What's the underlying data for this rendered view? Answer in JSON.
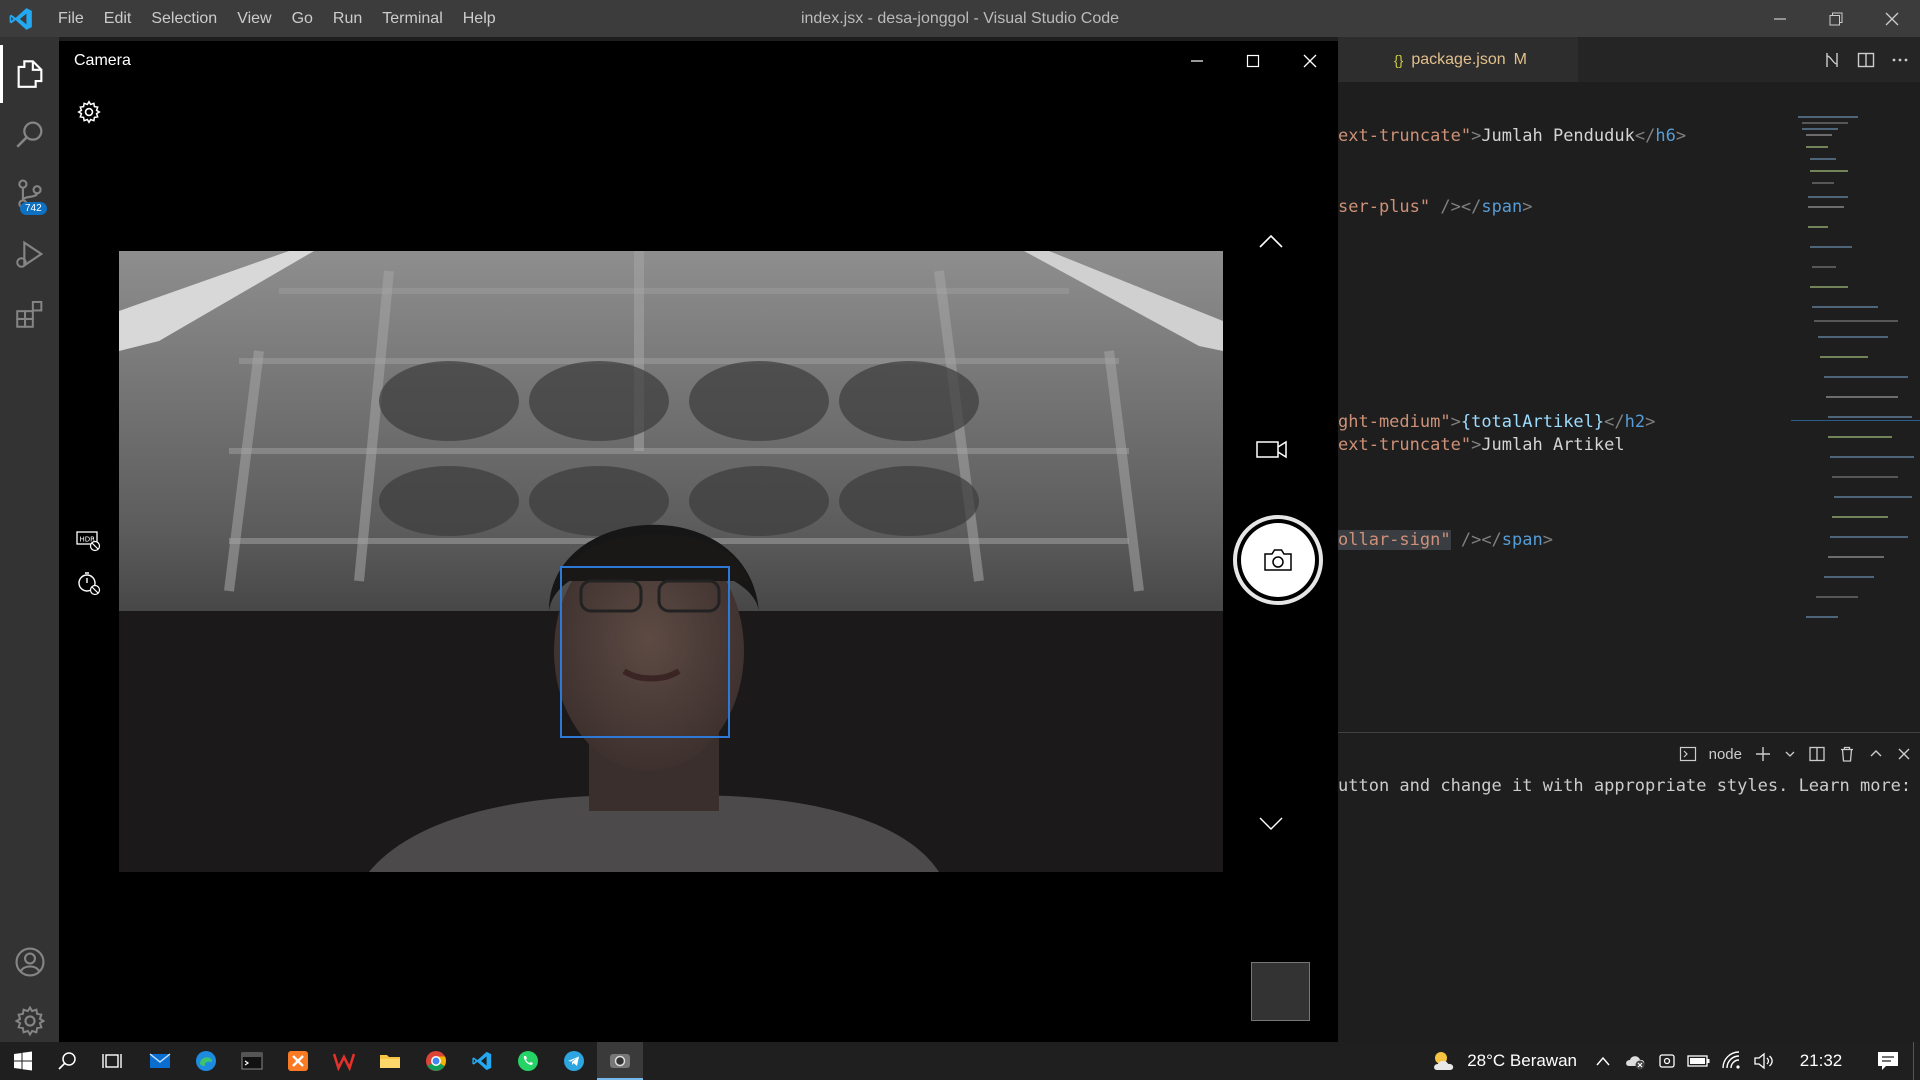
{
  "vscode": {
    "title": "index.jsx - desa-jonggol - Visual Studio Code",
    "menu": [
      "File",
      "Edit",
      "Selection",
      "View",
      "Go",
      "Run",
      "Terminal",
      "Help"
    ],
    "scm_badge": "742",
    "tab": {
      "icon": "{}",
      "label": "package.json",
      "status": "M"
    },
    "code_lines": [
      {
        "parts": [
          {
            "c": "str",
            "t": "ext-truncate\""
          },
          {
            "c": "br",
            "t": ">"
          },
          {
            "c": "txt",
            "t": "Jumlah Penduduk"
          },
          {
            "c": "br",
            "t": "</"
          },
          {
            "c": "tag",
            "t": "h6"
          },
          {
            "c": "br",
            "t": ">"
          }
        ]
      },
      {
        "parts": [
          {
            "c": "str",
            "t": "ser-plus\""
          },
          {
            "c": "txt",
            "t": " "
          },
          {
            "c": "br",
            "t": "/></"
          },
          {
            "c": "tag",
            "t": "span"
          },
          {
            "c": "br",
            "t": ">"
          }
        ]
      },
      {
        "parts": [
          {
            "c": "str",
            "t": "ght-medium\""
          },
          {
            "c": "br",
            "t": ">"
          },
          {
            "c": "var",
            "t": "{totalArtikel}"
          },
          {
            "c": "br",
            "t": "</"
          },
          {
            "c": "tag",
            "t": "h2"
          },
          {
            "c": "br",
            "t": ">"
          }
        ]
      },
      {
        "parts": [
          {
            "c": "str",
            "t": "ext-truncate\""
          },
          {
            "c": "br",
            "t": ">"
          },
          {
            "c": "txt",
            "t": "Jumlah Artikel"
          }
        ]
      },
      {
        "parts": [
          {
            "c": "str",
            "t": "ollar-sign\""
          },
          {
            "c": "txt",
            "t": " "
          },
          {
            "c": "br",
            "t": "/></"
          },
          {
            "c": "tag",
            "t": "span"
          },
          {
            "c": "br",
            "t": ">"
          }
        ]
      }
    ],
    "terminal": {
      "shell": "node",
      "line": "utton and change it with appropriate styles. Learn more: https"
    }
  },
  "camera": {
    "title": "Camera"
  },
  "taskbar": {
    "weather": "28°C  Berawan",
    "time": "21:32"
  },
  "colors": {
    "accent": "#007acc",
    "face_box": "#2f79d6",
    "badge": "#0e70c0"
  }
}
